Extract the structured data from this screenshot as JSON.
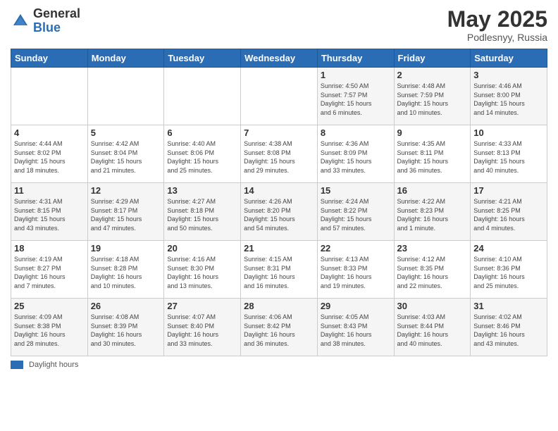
{
  "header": {
    "logo_general": "General",
    "logo_blue": "Blue",
    "month": "May 2025",
    "location": "Podlesnyy, Russia"
  },
  "days_of_week": [
    "Sunday",
    "Monday",
    "Tuesday",
    "Wednesday",
    "Thursday",
    "Friday",
    "Saturday"
  ],
  "footer": {
    "legend_label": "Daylight hours"
  },
  "weeks": [
    [
      {
        "day": "",
        "info": ""
      },
      {
        "day": "",
        "info": ""
      },
      {
        "day": "",
        "info": ""
      },
      {
        "day": "",
        "info": ""
      },
      {
        "day": "1",
        "info": "Sunrise: 4:50 AM\nSunset: 7:57 PM\nDaylight: 15 hours\nand 6 minutes."
      },
      {
        "day": "2",
        "info": "Sunrise: 4:48 AM\nSunset: 7:59 PM\nDaylight: 15 hours\nand 10 minutes."
      },
      {
        "day": "3",
        "info": "Sunrise: 4:46 AM\nSunset: 8:00 PM\nDaylight: 15 hours\nand 14 minutes."
      }
    ],
    [
      {
        "day": "4",
        "info": "Sunrise: 4:44 AM\nSunset: 8:02 PM\nDaylight: 15 hours\nand 18 minutes."
      },
      {
        "day": "5",
        "info": "Sunrise: 4:42 AM\nSunset: 8:04 PM\nDaylight: 15 hours\nand 21 minutes."
      },
      {
        "day": "6",
        "info": "Sunrise: 4:40 AM\nSunset: 8:06 PM\nDaylight: 15 hours\nand 25 minutes."
      },
      {
        "day": "7",
        "info": "Sunrise: 4:38 AM\nSunset: 8:08 PM\nDaylight: 15 hours\nand 29 minutes."
      },
      {
        "day": "8",
        "info": "Sunrise: 4:36 AM\nSunset: 8:09 PM\nDaylight: 15 hours\nand 33 minutes."
      },
      {
        "day": "9",
        "info": "Sunrise: 4:35 AM\nSunset: 8:11 PM\nDaylight: 15 hours\nand 36 minutes."
      },
      {
        "day": "10",
        "info": "Sunrise: 4:33 AM\nSunset: 8:13 PM\nDaylight: 15 hours\nand 40 minutes."
      }
    ],
    [
      {
        "day": "11",
        "info": "Sunrise: 4:31 AM\nSunset: 8:15 PM\nDaylight: 15 hours\nand 43 minutes."
      },
      {
        "day": "12",
        "info": "Sunrise: 4:29 AM\nSunset: 8:17 PM\nDaylight: 15 hours\nand 47 minutes."
      },
      {
        "day": "13",
        "info": "Sunrise: 4:27 AM\nSunset: 8:18 PM\nDaylight: 15 hours\nand 50 minutes."
      },
      {
        "day": "14",
        "info": "Sunrise: 4:26 AM\nSunset: 8:20 PM\nDaylight: 15 hours\nand 54 minutes."
      },
      {
        "day": "15",
        "info": "Sunrise: 4:24 AM\nSunset: 8:22 PM\nDaylight: 15 hours\nand 57 minutes."
      },
      {
        "day": "16",
        "info": "Sunrise: 4:22 AM\nSunset: 8:23 PM\nDaylight: 16 hours\nand 1 minute."
      },
      {
        "day": "17",
        "info": "Sunrise: 4:21 AM\nSunset: 8:25 PM\nDaylight: 16 hours\nand 4 minutes."
      }
    ],
    [
      {
        "day": "18",
        "info": "Sunrise: 4:19 AM\nSunset: 8:27 PM\nDaylight: 16 hours\nand 7 minutes."
      },
      {
        "day": "19",
        "info": "Sunrise: 4:18 AM\nSunset: 8:28 PM\nDaylight: 16 hours\nand 10 minutes."
      },
      {
        "day": "20",
        "info": "Sunrise: 4:16 AM\nSunset: 8:30 PM\nDaylight: 16 hours\nand 13 minutes."
      },
      {
        "day": "21",
        "info": "Sunrise: 4:15 AM\nSunset: 8:31 PM\nDaylight: 16 hours\nand 16 minutes."
      },
      {
        "day": "22",
        "info": "Sunrise: 4:13 AM\nSunset: 8:33 PM\nDaylight: 16 hours\nand 19 minutes."
      },
      {
        "day": "23",
        "info": "Sunrise: 4:12 AM\nSunset: 8:35 PM\nDaylight: 16 hours\nand 22 minutes."
      },
      {
        "day": "24",
        "info": "Sunrise: 4:10 AM\nSunset: 8:36 PM\nDaylight: 16 hours\nand 25 minutes."
      }
    ],
    [
      {
        "day": "25",
        "info": "Sunrise: 4:09 AM\nSunset: 8:38 PM\nDaylight: 16 hours\nand 28 minutes."
      },
      {
        "day": "26",
        "info": "Sunrise: 4:08 AM\nSunset: 8:39 PM\nDaylight: 16 hours\nand 30 minutes."
      },
      {
        "day": "27",
        "info": "Sunrise: 4:07 AM\nSunset: 8:40 PM\nDaylight: 16 hours\nand 33 minutes."
      },
      {
        "day": "28",
        "info": "Sunrise: 4:06 AM\nSunset: 8:42 PM\nDaylight: 16 hours\nand 36 minutes."
      },
      {
        "day": "29",
        "info": "Sunrise: 4:05 AM\nSunset: 8:43 PM\nDaylight: 16 hours\nand 38 minutes."
      },
      {
        "day": "30",
        "info": "Sunrise: 4:03 AM\nSunset: 8:44 PM\nDaylight: 16 hours\nand 40 minutes."
      },
      {
        "day": "31",
        "info": "Sunrise: 4:02 AM\nSunset: 8:46 PM\nDaylight: 16 hours\nand 43 minutes."
      }
    ]
  ]
}
